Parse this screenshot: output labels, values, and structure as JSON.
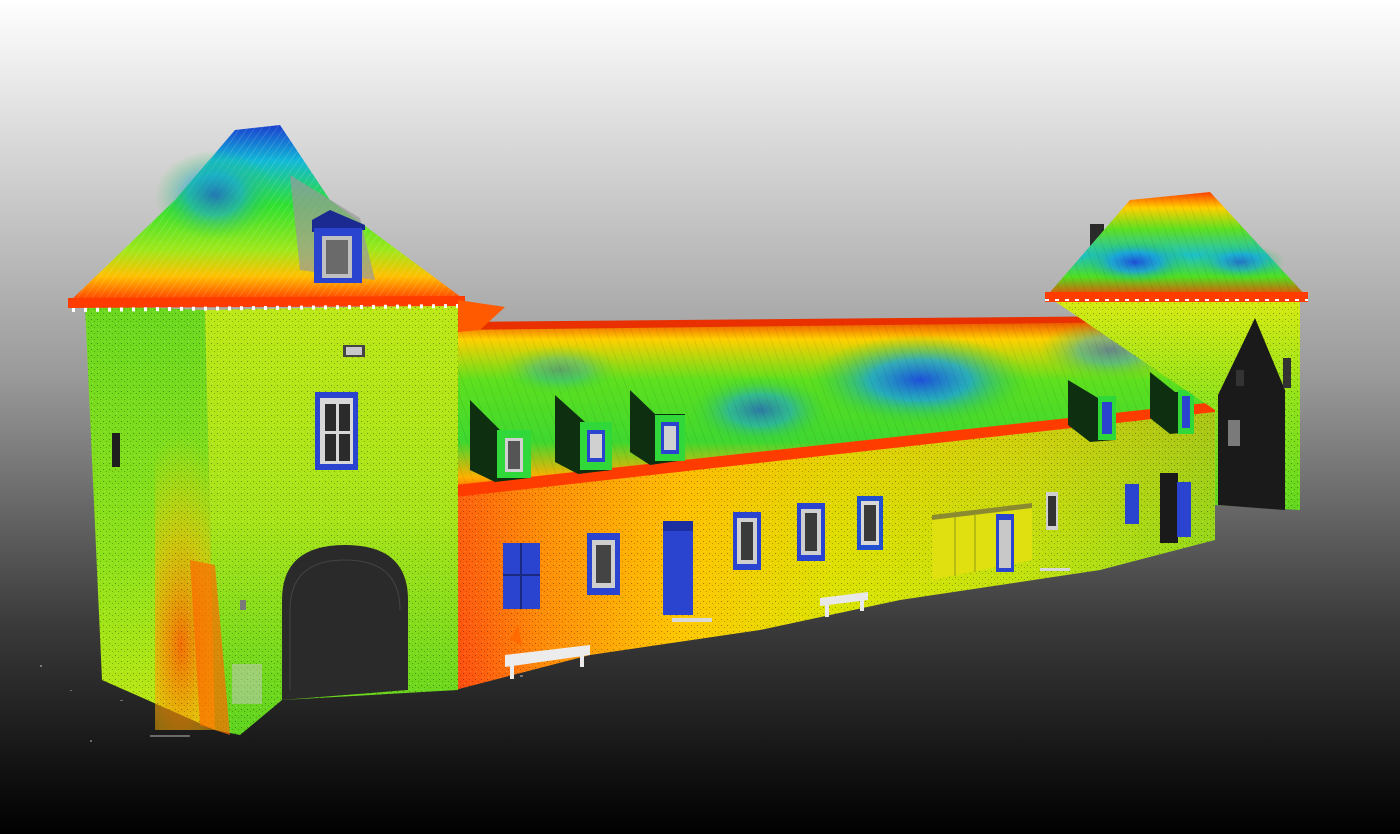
{
  "viewer": {
    "background": {
      "top": "#ffffff",
      "bottom": "#000000"
    },
    "colormap": [
      "#1e3cff",
      "#00c8ff",
      "#2ee82e",
      "#b6f000",
      "#ffe000",
      "#ff8a00",
      "#e82000"
    ]
  },
  "scene": {
    "subject": "point-cloud-building",
    "parts": [
      "left-tower",
      "central-wing",
      "right-tower"
    ],
    "colors": {
      "wall_green": "#7ee01e",
      "wall_yellow": "#d8e800",
      "wall_orange": "#ff9a10",
      "wall_red": "#ff4a00",
      "roof_blue": "#1e50d8",
      "window_blue": "#2a44d0",
      "opening_dark": "#1a1a1a"
    }
  }
}
